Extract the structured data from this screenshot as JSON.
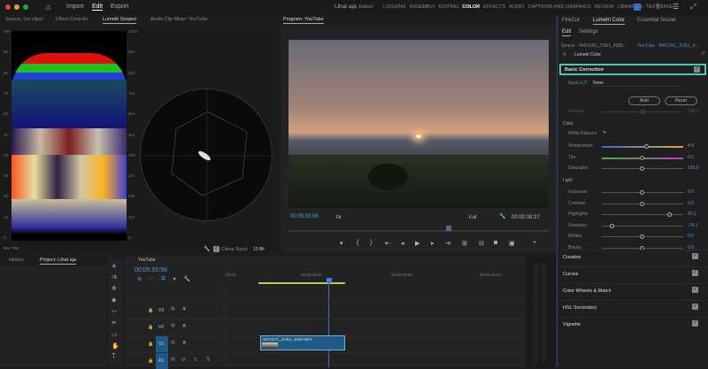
{
  "header": {
    "nav": [
      "Import",
      "Edit",
      "Export"
    ],
    "active_nav": "Edit",
    "title": "Lihat aja",
    "edited": "- Edited",
    "workspaces": [
      "LOGGING",
      "ASSEMBLY",
      "EDITING",
      "COLOR",
      "EFFECTS",
      "AUDIO",
      "CAPTIONS AND GRAPHICS",
      "REVIEW",
      "LIBRARIES",
      "TEXT-BASE"
    ],
    "active_workspace": "COLOR"
  },
  "source_panel": {
    "tabs": [
      "Source: (no clips)",
      "Effect Controls",
      "Lumetri Scopes",
      "Audio Clip Mixer: YouTube"
    ],
    "active": "Lumetri Scopes",
    "left_scale": [
      "100",
      "90",
      "80",
      "70",
      "60",
      "50",
      "40",
      "30",
      "20",
      "10",
      "0"
    ],
    "right_scale": [
      "1023",
      "921",
      "818",
      "716",
      "614",
      "512",
      "409",
      "307",
      "205",
      "102",
      "0"
    ],
    "colorspace": "Rec 709",
    "clamp_label": "Clamp Signal",
    "bit_depth": "10 Bit"
  },
  "program": {
    "tab": "Program: YouTube",
    "timecode": "00:05:55:56",
    "fit": "Fit",
    "quality": "Full",
    "duration": "00:00:08:37"
  },
  "lumetri": {
    "tabs": [
      "FireCut",
      "Lumetri Color",
      "Essential Sound"
    ],
    "active": "Lumetri Color",
    "subtabs": [
      "Edit",
      "Settings"
    ],
    "source": "Source · WATZAC_ZVE1_4368...",
    "target": "YouTube · WATZAC_ZVE1_4...",
    "effect": "Lumetri Color",
    "basic": "Basic Correction",
    "input_lut_label": "Input LUT",
    "input_lut": "None",
    "auto": "Auto",
    "reset": "Reset",
    "intensity": "Intensity",
    "intensity_val": "100.0",
    "color_section": "Color",
    "white_balance": "White Balance",
    "light_section": "Light",
    "sliders": [
      {
        "label": "Temperature",
        "value": "4.8",
        "pos": 0.55,
        "track": "temp"
      },
      {
        "label": "Tint",
        "value": "0.0",
        "pos": 0.5,
        "track": "tint"
      },
      {
        "label": "Saturation",
        "value": "100.0",
        "pos": 0.5,
        "track": "plain"
      },
      {
        "label": "Exposure",
        "value": "0.0",
        "pos": 0.5,
        "track": "plain"
      },
      {
        "label": "Contrast",
        "value": "0.0",
        "pos": 0.5,
        "track": "plain"
      },
      {
        "label": "Highlights",
        "value": "47.2",
        "pos": 0.84,
        "track": "plain"
      },
      {
        "label": "Shadows",
        "value": "-74.1",
        "pos": 0.13,
        "track": "plain"
      },
      {
        "label": "Whites",
        "value": "0.0",
        "pos": 0.5,
        "track": "plain"
      },
      {
        "label": "Blacks",
        "value": "0.0",
        "pos": 0.5,
        "track": "plain"
      }
    ],
    "sections": [
      "Creative",
      "Curves",
      "Color Wheels & Match",
      "HSL Secondary",
      "Vignette"
    ]
  },
  "project": {
    "tabs": [
      "History",
      "Project: Lihat aja"
    ],
    "active": "Project: Lihat aja"
  },
  "timeline": {
    "tab": "YouTube",
    "timecode": "00:05:55:56",
    "ruler": [
      ":00:00",
      "00:05:55:00",
      "00:06:00:00",
      "00:06:05:00"
    ],
    "tracks": [
      "V3",
      "V2",
      "V1",
      "A1"
    ],
    "clip": "WATZAC_ZVE1_4368.MP4",
    "audio_btns": [
      "M",
      "S"
    ]
  }
}
